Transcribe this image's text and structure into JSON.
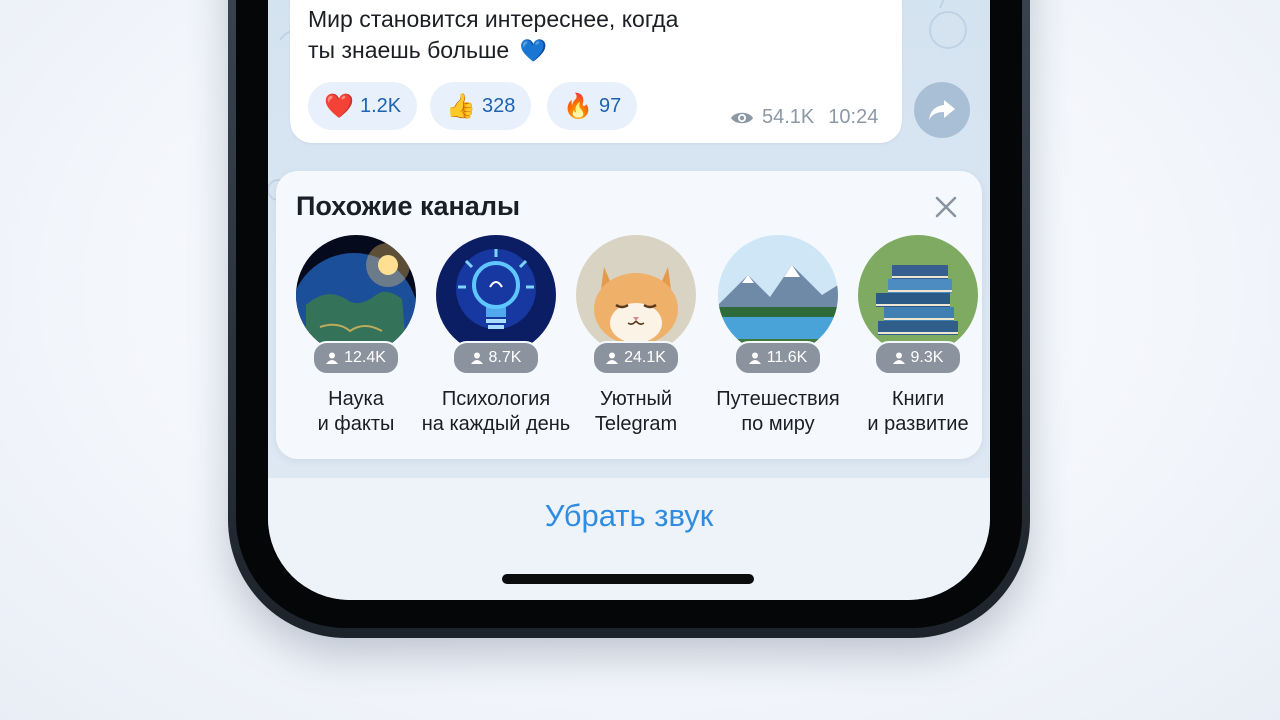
{
  "message": {
    "line1": "Мир становится интереснее, когда",
    "line2": "ты знаешь больше",
    "emoji": "💙",
    "reactions": [
      {
        "emoji": "❤️",
        "count": "1.2K"
      },
      {
        "emoji": "👍",
        "count": "328"
      },
      {
        "emoji": "🔥",
        "count": "97"
      }
    ],
    "views": "54.1K",
    "time": "10:24"
  },
  "similar": {
    "title": "Похожие каналы",
    "channels": [
      {
        "subs": "12.4K",
        "name": "Наука\nи факты",
        "icon": "earth"
      },
      {
        "subs": "8.7K",
        "name": "Психология\nна каждый день",
        "icon": "lightbulb"
      },
      {
        "subs": "24.1K",
        "name": "Уютный\nTelegram",
        "icon": "cat"
      },
      {
        "subs": "11.6K",
        "name": "Путешествия\nпо миру",
        "icon": "mountains"
      },
      {
        "subs": "9.3K",
        "name": "Книги\nи развитие",
        "icon": "books"
      }
    ]
  },
  "bottom": {
    "mute_label": "Убрать звук"
  },
  "colors": {
    "accent": "#2f8ce0",
    "card_bg": "#f5f9fd",
    "chat_bg": "#d3e2f0"
  }
}
